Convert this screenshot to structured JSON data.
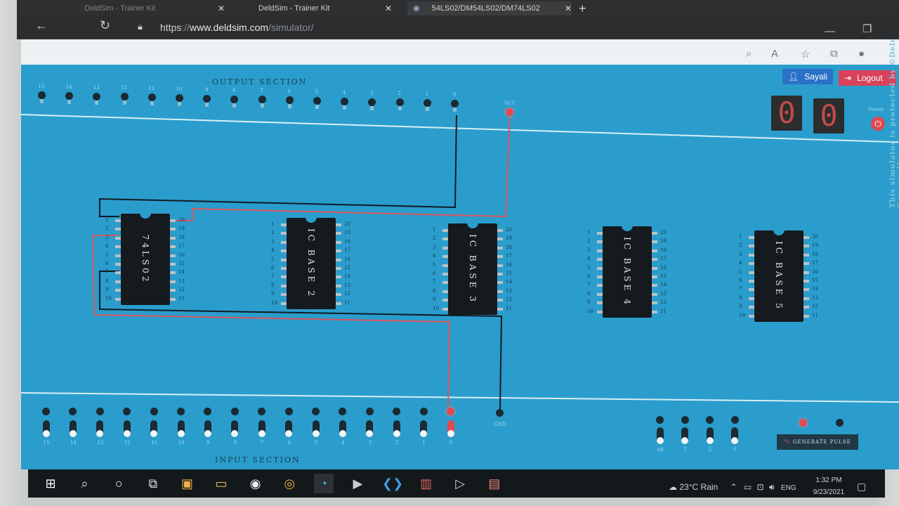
{
  "browser": {
    "tabs": [
      {
        "title": "DeldSim - Trainer Kit"
      },
      {
        "title": "DeldSim - Trainer Kit"
      },
      {
        "title": "54LS02/DM54LS02/DM74LS02"
      }
    ],
    "new_tab_symbol": "+",
    "address": {
      "scheme": "https",
      "host": "www.deldsim.com",
      "path": "/simulator/"
    }
  },
  "header": {
    "user_name": "Sayali",
    "logout_label": "Logout"
  },
  "output_section": {
    "title": "OUTPUT SECTION",
    "led_labels": [
      "15",
      "14",
      "13",
      "12",
      "11",
      "10",
      "9",
      "8",
      "7",
      "6",
      "5",
      "4",
      "3",
      "2",
      "1",
      "0"
    ],
    "vcc_label": "VCC"
  },
  "display": {
    "digits": [
      "0",
      "0"
    ],
    "power_label": "Power"
  },
  "ics": [
    {
      "label": "74LS02",
      "pins_left": [
        "1",
        "2",
        "3",
        "4",
        "5",
        "6",
        "7",
        "8",
        "9",
        "10"
      ],
      "pins_right": [
        "20",
        "19",
        "18",
        "17",
        "16",
        "15",
        "14",
        "13",
        "12",
        "11"
      ]
    },
    {
      "label": "IC BASE 2",
      "pins_left": [
        "1",
        "2",
        "3",
        "4",
        "5",
        "6",
        "7",
        "8",
        "9",
        "10"
      ],
      "pins_right": [
        "20",
        "19",
        "18",
        "17",
        "16",
        "15",
        "14",
        "13",
        "12",
        "11"
      ]
    },
    {
      "label": "IC BASE 3",
      "pins_left": [
        "1",
        "2",
        "3",
        "4",
        "5",
        "6",
        "7",
        "8",
        "9",
        "10"
      ],
      "pins_right": [
        "20",
        "19",
        "18",
        "17",
        "16",
        "15",
        "14",
        "13",
        "12",
        "11"
      ]
    },
    {
      "label": "IC BASE 4",
      "pins_left": [
        "1",
        "2",
        "3",
        "4",
        "5",
        "6",
        "7",
        "8",
        "9",
        "10"
      ],
      "pins_right": [
        "20",
        "19",
        "18",
        "17",
        "16",
        "15",
        "14",
        "13",
        "12",
        "11"
      ]
    },
    {
      "label": "IC BASE 5",
      "pins_left": [
        "1",
        "2",
        "3",
        "4",
        "5",
        "6",
        "7",
        "8",
        "9",
        "10"
      ],
      "pins_right": [
        "20",
        "19",
        "18",
        "17",
        "16",
        "15",
        "14",
        "13",
        "12",
        "11"
      ]
    }
  ],
  "input_section": {
    "title": "INPUT SECTION",
    "switch_labels": [
      "15",
      "14",
      "13",
      "12",
      "11",
      "10",
      "9",
      "8",
      "7",
      "6",
      "5",
      "4",
      "3",
      "2",
      "1",
      "0"
    ],
    "gnd_label": "GND",
    "aux_switch_labels": [
      "A8",
      "7",
      "2",
      "0"
    ],
    "generate_pulse_label": "GENERATE PULSE"
  },
  "watermark": "This simulator is protected by ©DeldSim Community",
  "taskbar": {
    "weather": "23°C Rain",
    "lang": "ENG",
    "time": "1:32 PM",
    "date": "9/23/2021",
    "apps": [
      "start",
      "search",
      "cortana",
      "task-view",
      "store",
      "file-explorer",
      "dell",
      "chrome",
      "edge",
      "terminal",
      "vscode",
      "books",
      "prime-video",
      "notepad"
    ]
  },
  "colors": {
    "page_bg": "#2a9dcc",
    "wire_red": "#d9545d",
    "wire_black": "#111b22",
    "led_on": "#e2484d"
  }
}
